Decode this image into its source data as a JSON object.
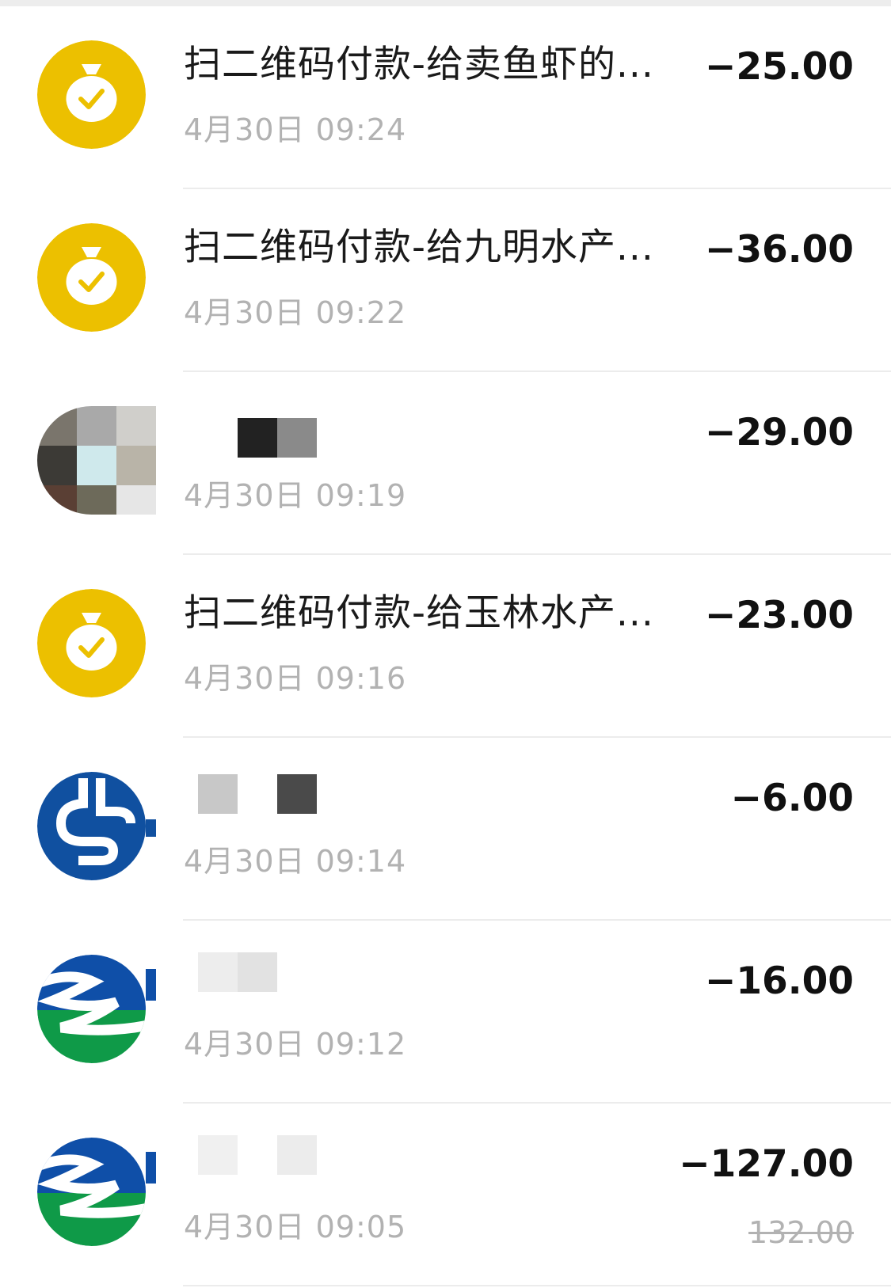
{
  "transactions": [
    {
      "title": "扫二维码付款-给卖鱼虾的...",
      "time": "4月30日 09:24",
      "amount": "−25.00",
      "icon": "wechat-pay-bag-icon"
    },
    {
      "title": "扫二维码付款-给九明水产...",
      "time": "4月30日 09:22",
      "amount": "−36.00",
      "icon": "wechat-pay-bag-icon"
    },
    {
      "title": "",
      "time": "4月30日 09:19",
      "amount": "−29.00",
      "icon": "user-photo-avatar"
    },
    {
      "title": "扫二维码付款-给玉林水产...",
      "time": "4月30日 09:16",
      "amount": "−23.00",
      "icon": "wechat-pay-bag-icon"
    },
    {
      "title": "",
      "time": "4月30日 09:14",
      "amount": "−6.00",
      "icon": "bank-logo-icon"
    },
    {
      "title": "",
      "time": "4月30日 09:12",
      "amount": "−16.00",
      "icon": "river-logo-icon"
    },
    {
      "title": "",
      "time": "4月30日 09:05",
      "amount": "−127.00",
      "original_amount": "132.00",
      "icon": "river-logo-icon"
    }
  ],
  "colors": {
    "wechat_pay_yellow": "#ecc000",
    "bank_blue": "#1050a0",
    "river_blue": "#0f4fa8",
    "river_green": "#0f9a48",
    "time_gray": "#b2b2b2"
  }
}
